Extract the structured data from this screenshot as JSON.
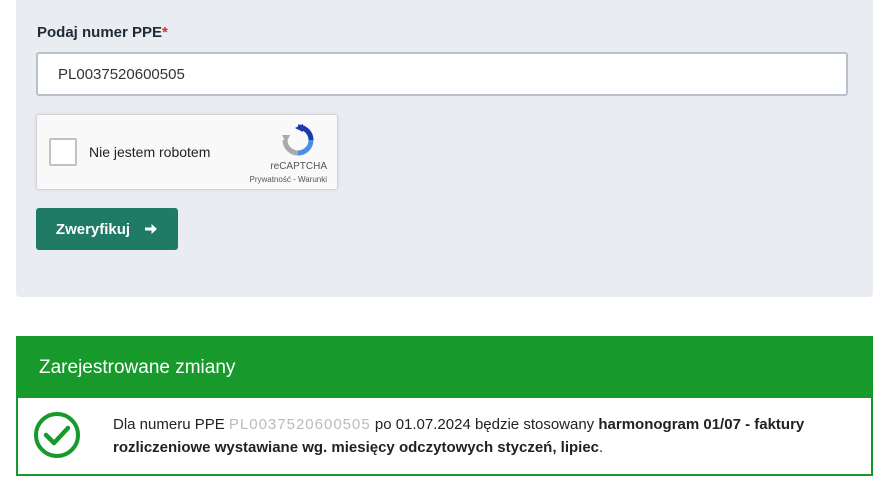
{
  "form": {
    "label": "Podaj numer PPE",
    "required_mark": "*",
    "ppe_value": "PL0037520600505",
    "recaptcha": {
      "checkbox_label": "Nie jestem robotem",
      "brand": "reCAPTCHA",
      "privacy_link": "Prywatność",
      "separator": " - ",
      "terms_link": "Warunki"
    },
    "verify_label": "Zweryfikuj",
    "verify_icon": "arrow-right-icon"
  },
  "result": {
    "header": "Zarejestrowane zmiany",
    "icon": "check-circle-icon",
    "colors": {
      "accent": "#179a2b",
      "button": "#1f7a66"
    },
    "text_before": "Dla numeru PPE ",
    "ppe_masked": "PL0037520600505",
    "text_after": " po 01.07.2024 będzie stosowany ",
    "bold_text": "harmonogram 01/07 - faktury rozliczeniowe wystawiane wg. miesięcy odczytowych styczeń, lipiec",
    "ending": "."
  }
}
